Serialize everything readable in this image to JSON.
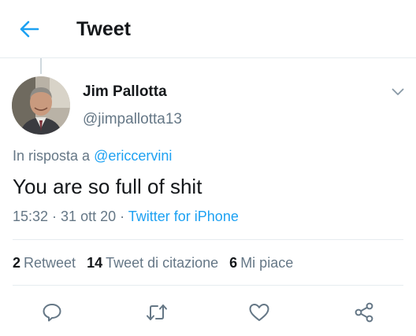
{
  "header": {
    "title": "Tweet",
    "back_icon": "arrow-left-icon",
    "accent_color": "#1da1f2"
  },
  "tweet": {
    "author_name": "Jim Pallotta",
    "author_handle": "@jimpallotta13",
    "reply_prefix": "In risposta a ",
    "reply_mention": "@ericcervini",
    "text": "You are so full of shit",
    "time": "15:32",
    "separator": " · ",
    "date": "31 ott 20",
    "source": "Twitter for iPhone"
  },
  "stats": {
    "retweets_count": "2",
    "retweets_label": "Retweet",
    "quotes_count": "14",
    "quotes_label": "Tweet di citazione",
    "likes_count": "6",
    "likes_label": "Mi piace"
  },
  "actions": [
    {
      "icon": "reply-icon"
    },
    {
      "icon": "retweet-icon"
    },
    {
      "icon": "heart-icon"
    },
    {
      "icon": "share-icon"
    }
  ],
  "colors": {
    "text_primary": "#14171a",
    "text_secondary": "#657786",
    "link": "#1da1f2",
    "divider": "#e6ecf0"
  }
}
